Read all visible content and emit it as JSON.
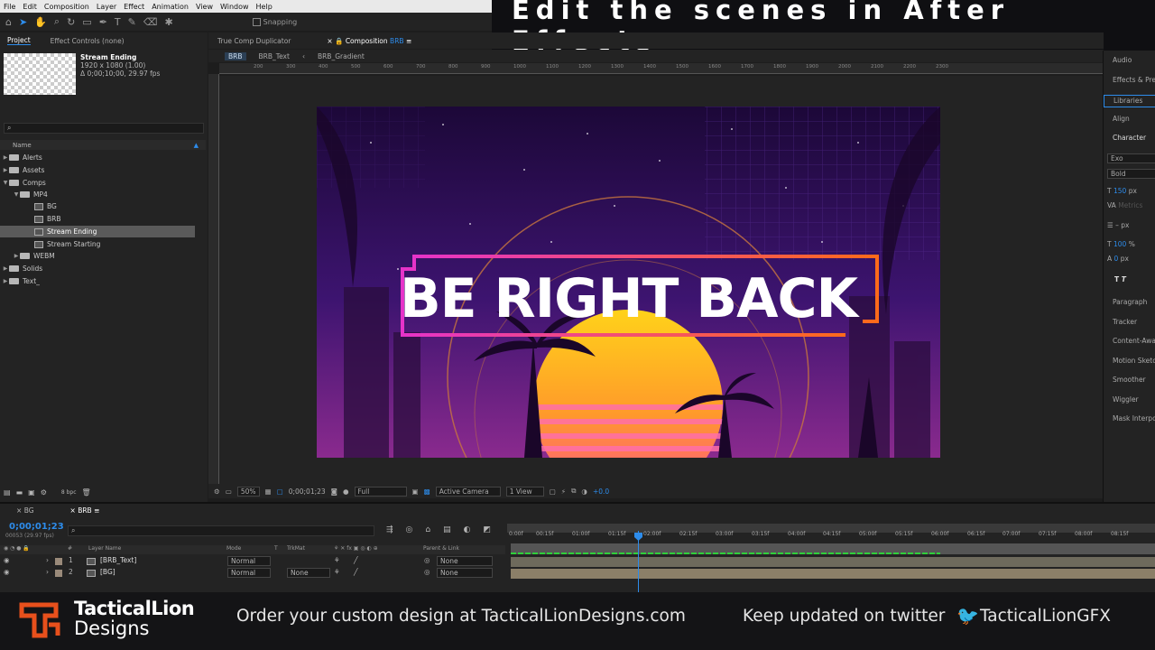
{
  "menu": [
    "File",
    "Edit",
    "Composition",
    "Layer",
    "Effect",
    "Animation",
    "View",
    "Window",
    "Help"
  ],
  "toolbar": {
    "snapping": "Snapping"
  },
  "banner": {
    "text": "Edit the scenes in After Effects"
  },
  "project": {
    "tab_project": "Project",
    "tab_effects": "Effect Controls (none)",
    "comp_name": "Stream Ending",
    "comp_res": "1920 x 1080 (1.00)",
    "comp_dur": "Δ 0;00;10;00, 29.97 fps",
    "search_placeholder": "",
    "col_name": "Name",
    "tree": [
      "Alerts",
      "Assets",
      "Comps",
      "MP4",
      "BG",
      "BRB",
      "Stream Ending",
      "Stream Starting",
      "WEBM",
      "Solids",
      "Text_"
    ],
    "bpc": "8 bpc"
  },
  "viewer": {
    "tab_dup": "True Comp Duplicator",
    "tab_comp": "Composition",
    "tab_comp_name": "BRB",
    "crumb_1": "BRB",
    "crumb_2": "BRB_Text",
    "crumb_3": "BRB_Gradient",
    "ruler_ticks": [
      "200",
      "300",
      "400",
      "500",
      "600",
      "700",
      "800",
      "900",
      "1000",
      "1100",
      "1200",
      "1300",
      "1400",
      "1500",
      "1600",
      "1700",
      "1800",
      "1900",
      "2000",
      "2100",
      "2200",
      "2300"
    ],
    "headline": "BE RIGHT BACK",
    "zoom": "50%",
    "timecode": "0;00;01;23",
    "resolution": "Full",
    "camera": "Active Camera",
    "views": "1 View",
    "exposure": "+0.0"
  },
  "right_panel": {
    "items": [
      "Audio",
      "Effects & Presets",
      "Libraries",
      "Align",
      "Character"
    ],
    "font": "Exo",
    "style": "Bold",
    "size": "150",
    "size_unit": "px",
    "kerning": "Metrics",
    "leading_unit": "px",
    "scale": "100",
    "scale_unit": "%",
    "baseline": "0",
    "baseline_unit": "px",
    "lower_items": [
      "Paragraph",
      "Tracker",
      "Content-Aware Fill",
      "Motion Sketch",
      "Smoother",
      "Wiggler",
      "Mask Interpolation"
    ]
  },
  "timeline": {
    "tab_bg": "BG",
    "tab_brb": "BRB",
    "timecode": "0;00;01;23",
    "frames": "00053 (29.97 fps)",
    "col_num": "#",
    "col_layer": "Layer Name",
    "col_mode": "Mode",
    "col_t": "T",
    "col_trkmat": "TrkMat",
    "col_parent": "Parent & Link",
    "rulers": [
      "0:00f",
      "00:15f",
      "01:00f",
      "01:15f",
      "02:00f",
      "02:15f",
      "03:00f",
      "03:15f",
      "04:00f",
      "04:15f",
      "05:00f",
      "05:15f",
      "06:00f",
      "06:15f",
      "07:00f",
      "07:15f",
      "08:00f",
      "08:15f"
    ],
    "layers": [
      {
        "num": "1",
        "name": "[BRB_Text]",
        "mode": "Normal",
        "trkmat": "",
        "parent": "None"
      },
      {
        "num": "2",
        "name": "[BG]",
        "mode": "Normal",
        "trkmat": "None",
        "parent": "None"
      }
    ]
  },
  "footer": {
    "brand_1": "TacticalLion",
    "brand_2": "Designs",
    "order": "Order your custom design at TacticalLionDesigns.com",
    "keep": "Keep updated on twitter",
    "handle": "TacticalLionGFX"
  },
  "colors": {
    "accent_blue": "#2d8ceb",
    "brand_orange": "#e8501c",
    "twitter": "#ff6a00"
  }
}
